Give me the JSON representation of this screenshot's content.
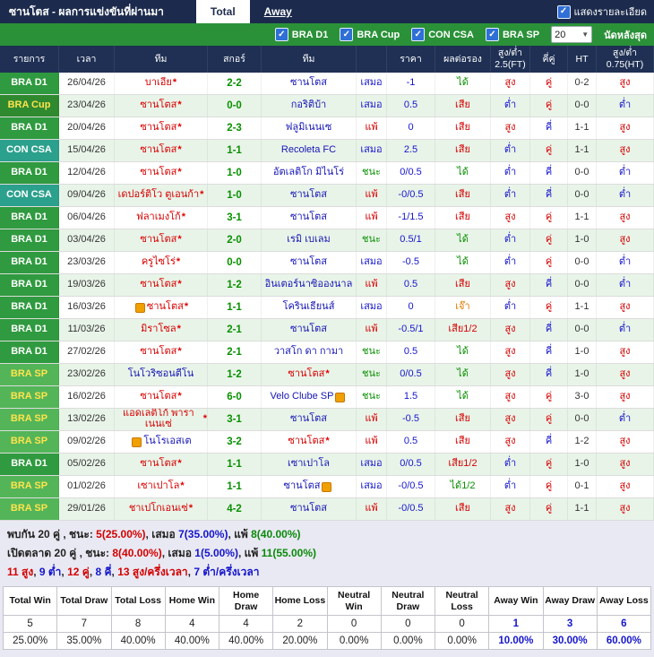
{
  "title_bar": {
    "title": "ซานโตส - ผลการแข่งขันที่ผ่านมา",
    "tabs": [
      {
        "label": "Total",
        "active": true
      },
      {
        "label": "Away",
        "active": false
      }
    ],
    "show_details_label": "แสดงรายละเอียด"
  },
  "filter_bar": {
    "leagues": [
      "BRA D1",
      "BRA Cup",
      "CON CSA",
      "BRA SP"
    ],
    "match_count": "20",
    "match_count_suffix": "นัดหลังสุด"
  },
  "colors": {
    "bar_navy": "#1c2b4d",
    "bar_green": "#2a9138",
    "win_green": "#089000",
    "lose_red": "#d40000",
    "draw_blue": "#1515cc",
    "push_orange": "#e07800",
    "badge_bra_d1": "#2f9a3f",
    "badge_bra_cup": "#2f8a2f",
    "badge_con_csa": "#2ba08c",
    "badge_bra_sp": "#53b558"
  },
  "results_table": {
    "columns": [
      "รายการ",
      "เวลา",
      "ทีม",
      "สกอร์",
      "ทีม",
      "",
      "ราคา",
      "ผลต่อรอง",
      "สูง/ต่ำ 2.5(FT)",
      "คี่คู่",
      "HT",
      "สูง/ต่ำ 0.75(HT)"
    ],
    "rows": [
      {
        "league": "BRA D1",
        "date": "26/04/26",
        "home": "บาเอีย",
        "home_star": true,
        "home_icon": false,
        "score": "2-2",
        "away": "ซานโตส",
        "away_star": false,
        "away_icon": false,
        "result": "เสมอ",
        "odds": "-1",
        "handicap": "ได้",
        "over_under": "สูง",
        "odd_even": "คู่",
        "ht": "0-2",
        "over_under_ht": "สูง"
      },
      {
        "league": "BRA Cup",
        "date": "23/04/26",
        "home": "ซานโตส",
        "home_star": true,
        "home_icon": false,
        "score": "0-0",
        "away": "กอริติบ้า",
        "away_star": false,
        "away_icon": false,
        "result": "เสมอ",
        "odds": "0.5",
        "handicap": "เสีย",
        "over_under": "ต่ำ",
        "odd_even": "คู่",
        "ht": "0-0",
        "over_under_ht": "ต่ำ"
      },
      {
        "league": "BRA D1",
        "date": "20/04/26",
        "home": "ซานโตส",
        "home_star": true,
        "home_icon": false,
        "score": "2-3",
        "away": "ฟลูมิเนนเซ",
        "away_star": false,
        "away_icon": false,
        "result": "แพ้",
        "odds": "0",
        "handicap": "เสีย",
        "over_under": "สูง",
        "odd_even": "คี่",
        "ht": "1-1",
        "over_under_ht": "สูง"
      },
      {
        "league": "CON CSA",
        "date": "15/04/26",
        "home": "ซานโตส",
        "home_star": true,
        "home_icon": false,
        "score": "1-1",
        "away": "Recoleta FC",
        "away_star": false,
        "away_icon": false,
        "result": "เสมอ",
        "odds": "2.5",
        "handicap": "เสีย",
        "over_under": "ต่ำ",
        "odd_even": "คู่",
        "ht": "1-1",
        "over_under_ht": "สูง"
      },
      {
        "league": "BRA D1",
        "date": "12/04/26",
        "home": "ซานโตส",
        "home_star": true,
        "home_icon": false,
        "score": "1-0",
        "away": "อัตเลติโก มิไนโร่",
        "away_star": false,
        "away_icon": false,
        "result": "ชนะ",
        "odds": "0/0.5",
        "handicap": "ได้",
        "over_under": "ต่ำ",
        "odd_even": "คี่",
        "ht": "0-0",
        "over_under_ht": "ต่ำ"
      },
      {
        "league": "CON CSA",
        "date": "09/04/26",
        "home": "เดปอร์ติโว ตูเอนก้า",
        "home_star": true,
        "home_icon": false,
        "score": "1-0",
        "away": "ซานโตส",
        "away_star": false,
        "away_icon": false,
        "result": "แพ้",
        "odds": "-0/0.5",
        "handicap": "เสีย",
        "over_under": "ต่ำ",
        "odd_even": "คี่",
        "ht": "0-0",
        "over_under_ht": "ต่ำ"
      },
      {
        "league": "BRA D1",
        "date": "06/04/26",
        "home": "ฟลาเมงโก้",
        "home_star": true,
        "home_icon": false,
        "score": "3-1",
        "away": "ซานโตส",
        "away_star": false,
        "away_icon": false,
        "result": "แพ้",
        "odds": "-1/1.5",
        "handicap": "เสีย",
        "over_under": "สูง",
        "odd_even": "คู่",
        "ht": "1-1",
        "over_under_ht": "สูง"
      },
      {
        "league": "BRA D1",
        "date": "03/04/26",
        "home": "ซานโตส",
        "home_star": true,
        "home_icon": false,
        "score": "2-0",
        "away": "เรมิ เบเลม",
        "away_star": false,
        "away_icon": false,
        "result": "ชนะ",
        "odds": "0.5/1",
        "handicap": "ได้",
        "over_under": "ต่ำ",
        "odd_even": "คู่",
        "ht": "1-0",
        "over_under_ht": "สูง"
      },
      {
        "league": "BRA D1",
        "date": "23/03/26",
        "home": "ครูไซโร่",
        "home_star": true,
        "home_icon": false,
        "score": "0-0",
        "away": "ซานโตส",
        "away_star": false,
        "away_icon": false,
        "result": "เสมอ",
        "odds": "-0.5",
        "handicap": "ได้",
        "over_under": "ต่ำ",
        "odd_even": "คู่",
        "ht": "0-0",
        "over_under_ht": "ต่ำ"
      },
      {
        "league": "BRA D1",
        "date": "19/03/26",
        "home": "ซานโตส",
        "home_star": true,
        "home_icon": false,
        "score": "1-2",
        "away": "อินเตอร์นาซิอองนาล",
        "away_star": false,
        "away_icon": false,
        "result": "แพ้",
        "odds": "0.5",
        "handicap": "เสีย",
        "over_under": "สูง",
        "odd_even": "คี่",
        "ht": "0-0",
        "over_under_ht": "ต่ำ"
      },
      {
        "league": "BRA D1",
        "date": "16/03/26",
        "home": "ซานโตส",
        "home_star": true,
        "home_icon": true,
        "score": "1-1",
        "away": "โครินเธียนส์",
        "away_star": false,
        "away_icon": false,
        "result": "เสมอ",
        "odds": "0",
        "handicap": "เจ๊า",
        "over_under": "ต่ำ",
        "odd_even": "คู่",
        "ht": "1-1",
        "over_under_ht": "สูง"
      },
      {
        "league": "BRA D1",
        "date": "11/03/26",
        "home": "มิราโซล",
        "home_star": true,
        "home_icon": false,
        "score": "2-1",
        "away": "ซานโตส",
        "away_star": false,
        "away_icon": false,
        "result": "แพ้",
        "odds": "-0.5/1",
        "handicap": "เสีย1/2",
        "over_under": "สูง",
        "odd_even": "คี่",
        "ht": "0-0",
        "over_under_ht": "ต่ำ"
      },
      {
        "league": "BRA D1",
        "date": "27/02/26",
        "home": "ซานโตส",
        "home_star": true,
        "home_icon": false,
        "score": "2-1",
        "away": "วาสโก ดา กามา",
        "away_star": false,
        "away_icon": false,
        "result": "ชนะ",
        "odds": "0.5",
        "handicap": "ได้",
        "over_under": "สูง",
        "odd_even": "คี่",
        "ht": "1-0",
        "over_under_ht": "สูง"
      },
      {
        "league": "BRA SP",
        "date": "23/02/26",
        "home": "โนโวริซอนตีโน",
        "home_star": false,
        "home_icon": false,
        "score": "1-2",
        "away": "ซานโตส",
        "away_star": true,
        "away_icon": false,
        "result": "ชนะ",
        "odds": "0/0.5",
        "handicap": "ได้",
        "over_under": "สูง",
        "odd_even": "คี่",
        "ht": "1-0",
        "over_under_ht": "สูง"
      },
      {
        "league": "BRA SP",
        "date": "16/02/26",
        "home": "ซานโตส",
        "home_star": true,
        "home_icon": false,
        "score": "6-0",
        "away": "Velo Clube SP",
        "away_star": false,
        "away_icon": true,
        "result": "ชนะ",
        "odds": "1.5",
        "handicap": "ได้",
        "over_under": "สูง",
        "odd_even": "คู่",
        "ht": "3-0",
        "over_under_ht": "สูง"
      },
      {
        "league": "BRA SP",
        "date": "13/02/26",
        "home": "แอดเลติโก้ พาราเนนเซ่",
        "home_star": true,
        "home_icon": false,
        "score": "3-1",
        "away": "ซานโตส",
        "away_star": false,
        "away_icon": false,
        "result": "แพ้",
        "odds": "-0.5",
        "handicap": "เสีย",
        "over_under": "สูง",
        "odd_even": "คู่",
        "ht": "0-0",
        "over_under_ht": "ต่ำ"
      },
      {
        "league": "BRA SP",
        "date": "09/02/26",
        "home": "โนโรเอสเต",
        "home_star": false,
        "home_icon": true,
        "score": "3-2",
        "away": "ซานโตส",
        "away_star": true,
        "away_icon": false,
        "result": "แพ้",
        "odds": "0.5",
        "handicap": "เสีย",
        "over_under": "สูง",
        "odd_even": "คี่",
        "ht": "1-2",
        "over_under_ht": "สูง"
      },
      {
        "league": "BRA D1",
        "date": "05/02/26",
        "home": "ซานโตส",
        "home_star": true,
        "home_icon": false,
        "score": "1-1",
        "away": "เซาเปาโล",
        "away_star": false,
        "away_icon": false,
        "result": "เสมอ",
        "odds": "0/0.5",
        "handicap": "เสีย1/2",
        "over_under": "ต่ำ",
        "odd_even": "คู่",
        "ht": "1-0",
        "over_under_ht": "สูง"
      },
      {
        "league": "BRA SP",
        "date": "01/02/26",
        "home": "เซาเปาโล",
        "home_star": true,
        "home_icon": false,
        "score": "1-1",
        "away": "ซานโตส",
        "away_star": false,
        "away_icon": true,
        "result": "เสมอ",
        "odds": "-0/0.5",
        "handicap": "ได้1/2",
        "over_under": "ต่ำ",
        "odd_even": "คู่",
        "ht": "0-1",
        "over_under_ht": "สูง"
      },
      {
        "league": "BRA SP",
        "date": "29/01/26",
        "home": "ชาเปโกเอนเซ่",
        "home_star": true,
        "home_icon": false,
        "score": "4-2",
        "away": "ซานโตส",
        "away_star": false,
        "away_icon": false,
        "result": "แพ้",
        "odds": "-0/0.5",
        "handicap": "เสีย",
        "over_under": "สูง",
        "odd_even": "คู่",
        "ht": "1-1",
        "over_under_ht": "สูง"
      }
    ]
  },
  "summary_lines": [
    {
      "segments": [
        {
          "t": "พบกัน 20 คู่ , ชนะ: ",
          "c": "black"
        },
        {
          "t": "5(25.00%)",
          "c": "red"
        },
        {
          "t": ", เสมอ ",
          "c": "black"
        },
        {
          "t": "7(35.00%)",
          "c": "blue"
        },
        {
          "t": ", แพ้ ",
          "c": "black"
        },
        {
          "t": "8(40.00%)",
          "c": "green"
        }
      ]
    },
    {
      "segments": [
        {
          "t": "เปิดตลาด 20 คู่ , ชนะ: ",
          "c": "black"
        },
        {
          "t": "8(40.00%)",
          "c": "red"
        },
        {
          "t": ", เสมอ ",
          "c": "black"
        },
        {
          "t": "1(5.00%)",
          "c": "blue"
        },
        {
          "t": ", แพ้ ",
          "c": "black"
        },
        {
          "t": "11(55.00%)",
          "c": "green"
        }
      ]
    },
    {
      "segments": [
        {
          "t": "11 สูง",
          "c": "red"
        },
        {
          "t": ", ",
          "c": "black"
        },
        {
          "t": "9 ต่ำ",
          "c": "blue"
        },
        {
          "t": ", ",
          "c": "black"
        },
        {
          "t": "12 คู่",
          "c": "red"
        },
        {
          "t": ", ",
          "c": "black"
        },
        {
          "t": "8 คี่",
          "c": "blue"
        },
        {
          "t": ", ",
          "c": "black"
        },
        {
          "t": "13 สูง/ครึ่งเวลา",
          "c": "red"
        },
        {
          "t": ", ",
          "c": "black"
        },
        {
          "t": "7 ต่ำ/ครึ่งเวลา",
          "c": "blue"
        }
      ]
    }
  ],
  "stats_table": {
    "headers": [
      "Total Win",
      "Total Draw",
      "Total Loss",
      "Home Win",
      "Home Draw",
      "Home Loss",
      "Neutral Win",
      "Neutral Draw",
      "Neutral Loss",
      "Away Win",
      "Away Draw",
      "Away Loss"
    ],
    "counts": [
      "5",
      "7",
      "8",
      "4",
      "4",
      "2",
      "0",
      "0",
      "0",
      "1",
      "3",
      "6"
    ],
    "percents": [
      "25.00%",
      "35.00%",
      "40.00%",
      "40.00%",
      "40.00%",
      "20.00%",
      "0.00%",
      "0.00%",
      "0.00%",
      "10.00%",
      "30.00%",
      "60.00%"
    ],
    "away_highlight_start_index": 9
  }
}
